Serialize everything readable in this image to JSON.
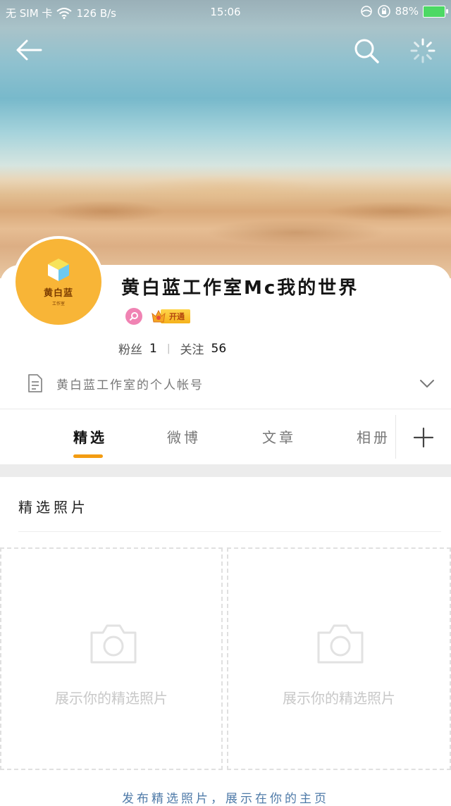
{
  "status_bar": {
    "carrier": "无 SIM 卡",
    "speed": "126 B/s",
    "time": "15:06",
    "battery": "88%"
  },
  "nav": {
    "back_icon": "back-arrow-icon",
    "search_icon": "search-icon",
    "more_icon": "loading-spinner-icon"
  },
  "profile": {
    "avatar_text": "黄白蓝",
    "avatar_subtext": "工作室",
    "name": "黄白蓝工作室Mc我的世界",
    "vip_label": "开通",
    "fans_label": "粉丝",
    "fans_count": "1",
    "following_label": "关注",
    "following_count": "56",
    "bio": "黄白蓝工作室的个人帐号"
  },
  "tabs": [
    {
      "label": "精选",
      "active": true
    },
    {
      "label": "微博",
      "active": false
    },
    {
      "label": "文章",
      "active": false
    },
    {
      "label": "相册",
      "active": false
    }
  ],
  "section": {
    "title": "精选照片",
    "slots": [
      {
        "label": "展示你的精选照片"
      },
      {
        "label": "展示你的精选照片"
      }
    ],
    "footer_link": "发布精选照片，展示在你的主页"
  },
  "colors": {
    "accent": "#f39c12",
    "link": "#4e7aa8",
    "avatar_bg": "#f8b537",
    "pink_badge": "#f083b3",
    "battery_fill": "#4cd964"
  }
}
